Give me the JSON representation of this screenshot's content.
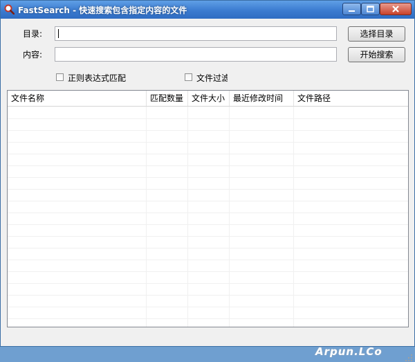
{
  "window": {
    "title": "FastSearch - 快速搜索包含指定内容的文件",
    "app_icon": "magnifier-icon",
    "title_bar_color": "#3b7bd0",
    "close_color": "#c8422b"
  },
  "form": {
    "directory_label": "目录:",
    "directory_value": "",
    "content_label": "内容:",
    "content_value": "",
    "choose_dir_button": "选择目录",
    "start_search_button": "开始搜索",
    "regex_checkbox": {
      "label": "正则表达式匹配",
      "checked": false
    },
    "file_filter_checkbox": {
      "label": "文件过滤",
      "checked": false
    }
  },
  "results": {
    "columns": [
      "文件名称",
      "匹配数量",
      "文件大小",
      "最近修改时间",
      "文件路径"
    ],
    "rows": []
  },
  "watermark": "Arpun.LCo"
}
